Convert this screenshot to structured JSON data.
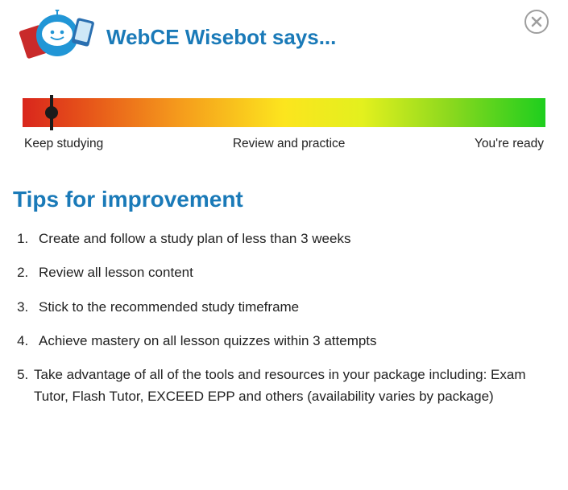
{
  "header": {
    "title": "WebCE Wisebot says..."
  },
  "gauge": {
    "marker_percent": 5.5,
    "labels": {
      "left": "Keep studying",
      "center": "Review and practice",
      "right": "You're ready"
    }
  },
  "section_title": "Tips for improvement",
  "tips": [
    "Create and follow a study plan of less than 3 weeks",
    "Review all lesson content",
    "Stick to the recommended study timeframe",
    "Achieve mastery on all lesson quizzes within 3 attempts",
    "Take advantage of all of the tools and resources in your package including: Exam Tutor, Flash Tutor, EXCEED EPP and others (availability varies by package)"
  ]
}
